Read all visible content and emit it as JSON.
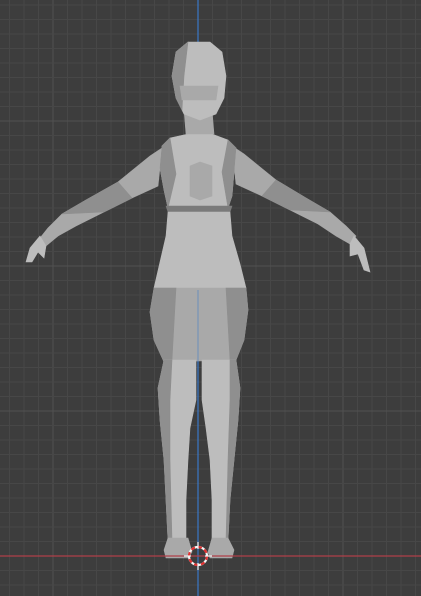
{
  "viewport": {
    "kind": "3d-viewport",
    "view": "front-orthographic",
    "overlays": {
      "grid": true,
      "z_axis_visible": true,
      "x_axis_visible": true,
      "cursor_3d_visible": true
    },
    "colors": {
      "background": "#3d3d3d",
      "grid_minor": "#474747",
      "grid_major": "#515151",
      "x_axis": "#b0404a",
      "z_axis": "#3a78c8",
      "mesh_light": "#bdbdbd",
      "mesh_mid": "#a9a9a9",
      "mesh_dark": "#8f8f8f",
      "mesh_shadow": "#7a7a7a",
      "cursor_red": "#e03030",
      "cursor_white": "#f4f4f4"
    }
  },
  "scene": {
    "object": "female-base-mesh",
    "pose": "a-pose",
    "shading": "solid"
  }
}
